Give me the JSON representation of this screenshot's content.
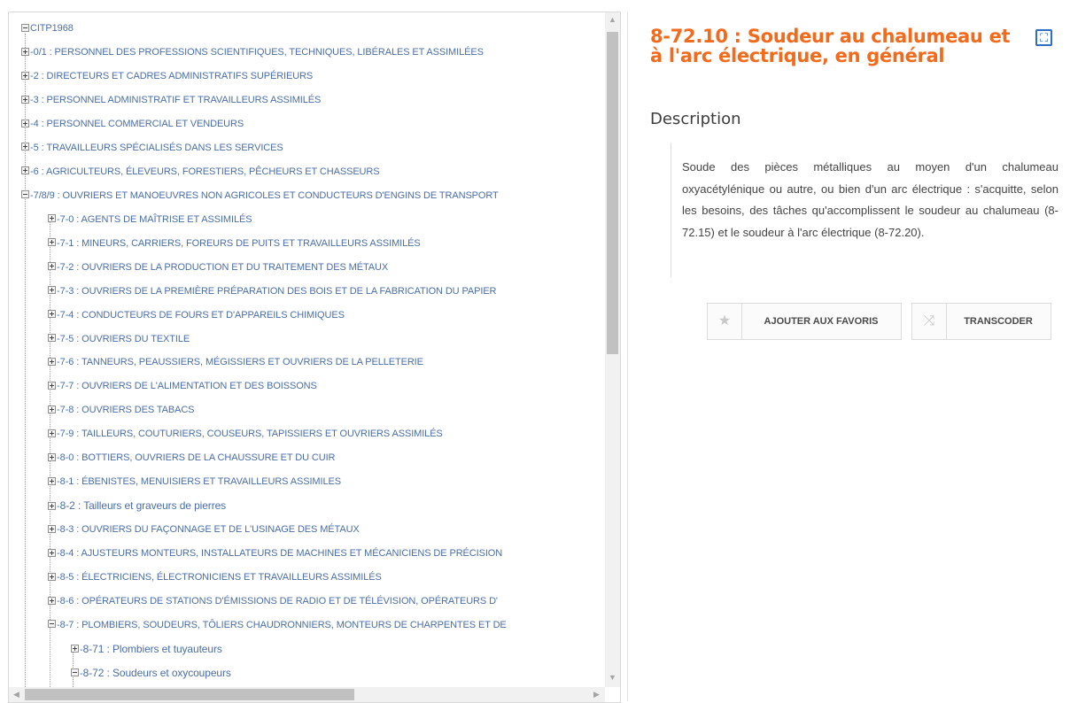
{
  "tree": {
    "root": "CITP1968",
    "items": [
      {
        "level": 1,
        "expander": "plus",
        "label": "0/1 : PERSONNEL DES PROFESSIONS SCIENTIFIQUES, TECHNIQUES, LIBÉRALES ET ASSIMILÉES"
      },
      {
        "level": 1,
        "expander": "plus",
        "label": "2 : DIRECTEURS ET CADRES ADMINISTRATIFS SUPÉRIEURS"
      },
      {
        "level": 1,
        "expander": "plus",
        "label": "3 : PERSONNEL ADMINISTRATIF ET TRAVAILLEURS ASSIMILÉS"
      },
      {
        "level": 1,
        "expander": "plus",
        "label": "4 : PERSONNEL COMMERCIAL ET VENDEURS"
      },
      {
        "level": 1,
        "expander": "plus",
        "label": "5 : TRAVAILLEURS SPÉCIALISÉS DANS LES SERVICES"
      },
      {
        "level": 1,
        "expander": "plus",
        "label": "6 : AGRICULTEURS, ÉLEVEURS, FORESTIERS, PÊCHEURS ET CHASSEURS"
      },
      {
        "level": 1,
        "expander": "minus",
        "label": "7/8/9 : OUVRIERS ET MANOEUVRES NON AGRICOLES ET CONDUCTEURS D'ENGINS DE TRANSPORT"
      },
      {
        "level": 2,
        "expander": "plus",
        "label": "7-0 : AGENTS DE MAÎTRISE ET ASSIMILÉS"
      },
      {
        "level": 2,
        "expander": "plus",
        "label": "7-1 : MINEURS, CARRIERS, FOREURS DE PUITS ET TRAVAILLEURS ASSIMILÉS"
      },
      {
        "level": 2,
        "expander": "plus",
        "label": "7-2 : OUVRIERS DE LA PRODUCTION ET DU TRAITEMENT DES MÉTAUX"
      },
      {
        "level": 2,
        "expander": "plus",
        "label": "7-3 : OUVRIERS DE LA PREMIÈRE PRÉPARATION DES BOIS ET DE LA FABRICATION DU PAPIER"
      },
      {
        "level": 2,
        "expander": "plus",
        "label": "7-4 : CONDUCTEURS DE FOURS ET D'APPAREILS CHIMIQUES"
      },
      {
        "level": 2,
        "expander": "plus",
        "label": "7-5 : OUVRIERS DU TEXTILE"
      },
      {
        "level": 2,
        "expander": "plus",
        "label": "7-6 : TANNEURS, PEAUSSIERS, MÉGISSIERS ET OUVRIERS DE LA PELLETERIE"
      },
      {
        "level": 2,
        "expander": "plus",
        "label": "7-7 : OUVRIERS DE L'ALIMENTATION ET DES BOISSONS"
      },
      {
        "level": 2,
        "expander": "plus",
        "label": "7-8 : OUVRIERS DES TABACS"
      },
      {
        "level": 2,
        "expander": "plus",
        "label": "7-9 : TAILLEURS, COUTURIERS, COUSEURS, TAPISSIERS ET OUVRIERS ASSIMILÉS"
      },
      {
        "level": 2,
        "expander": "plus",
        "label": "8-0 : BOTTIERS, OUVRIERS DE LA CHAUSSURE ET DU CUIR"
      },
      {
        "level": 2,
        "expander": "plus",
        "label": "8-1 : ÉBENISTES, MENUISIERS ET TRAVAILLEURS ASSIMILES"
      },
      {
        "level": 2,
        "expander": "plus",
        "label": "8-2 : Tailleurs et graveurs de pierres"
      },
      {
        "level": 2,
        "expander": "plus",
        "label": "8-3 : OUVRIERS DU FAÇONNAGE ET DE L'USINAGE DES MÉTAUX"
      },
      {
        "level": 2,
        "expander": "plus",
        "label": "8-4 : AJUSTEURS MONTEURS, INSTALLATEURS DE MACHINES ET MÉCANICIENS DE PRÉCISION"
      },
      {
        "level": 2,
        "expander": "plus",
        "label": "8-5 : ÉLECTRICIENS, ÉLECTRONICIENS ET TRAVAILLEURS ASSIMILÉS"
      },
      {
        "level": 2,
        "expander": "plus",
        "label": "8-6 : OPÉRATEURS DE STATIONS D'ÉMISSIONS DE RADIO ET DE TÉLÉVISION, OPÉRATEURS D'"
      },
      {
        "level": 2,
        "expander": "minus",
        "label": "8-7 : PLOMBIERS, SOUDEURS, TÔLIERS CHAUDRONNIERS, MONTEURS DE CHARPENTES ET DE"
      },
      {
        "level": 3,
        "expander": "plus",
        "label": "8-71 : Plombiers et tuyauteurs"
      },
      {
        "level": 3,
        "expander": "minus",
        "label": "8-72 : Soudeurs et oxycoupeurs"
      }
    ]
  },
  "detail": {
    "title": "8-72.10 : Soudeur au chalumeau et à l'arc électrique, en général",
    "description_heading": "Description",
    "description": "Soude des pièces métalliques au moyen d'un chalumeau oxyacétylénique ou autre, ou bien d'un arc électrique : s'acquitte, selon les besoins, des tâches qu'accomplissent le soudeur au chalumeau (8-72.15) et le soudeur à l'arc électrique (8-72.20).",
    "favorite_label": "AJOUTER AUX FAVORIS",
    "transcode_label": "TRANSCODER"
  },
  "icons": {
    "expand": "fullscreen-icon",
    "favorite": "star-icon",
    "transcode": "shuffle-icon"
  },
  "colors": {
    "title": "#f26a1b",
    "tree_link": "#4a6ea8",
    "expand_icon": "#2b6fc6"
  }
}
